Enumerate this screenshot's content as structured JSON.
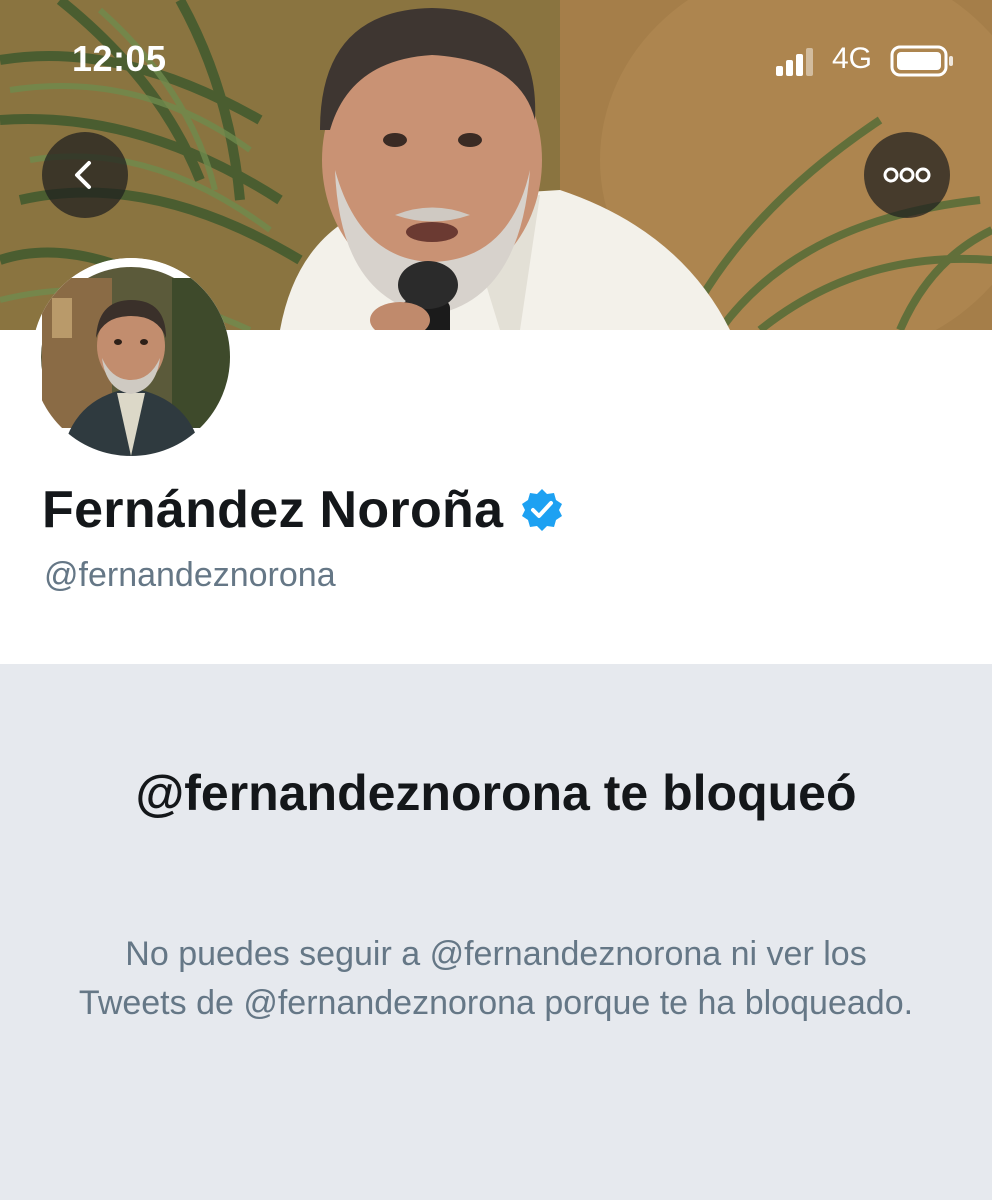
{
  "status_bar": {
    "time": "12:05",
    "network": "4G",
    "signal_icon": "signal-bars-icon",
    "battery_icon": "battery-icon"
  },
  "navigation": {
    "back_icon": "chevron-left-icon",
    "more_icon": "more-horizontal-icon"
  },
  "profile": {
    "display_name": "Fernández Noroña",
    "handle": "@fernandeznorona",
    "verified": true,
    "verified_color": "#1da1f2"
  },
  "blocked_notice": {
    "title": "@fernandeznorona te bloqueó",
    "message": "No puedes seguir a @fernandeznorona ni ver los Tweets de @fernandeznorona porque te ha bloqueado."
  },
  "colors": {
    "text_primary": "#14171a",
    "text_secondary": "#657786",
    "background_gray": "#e6e9ee"
  }
}
